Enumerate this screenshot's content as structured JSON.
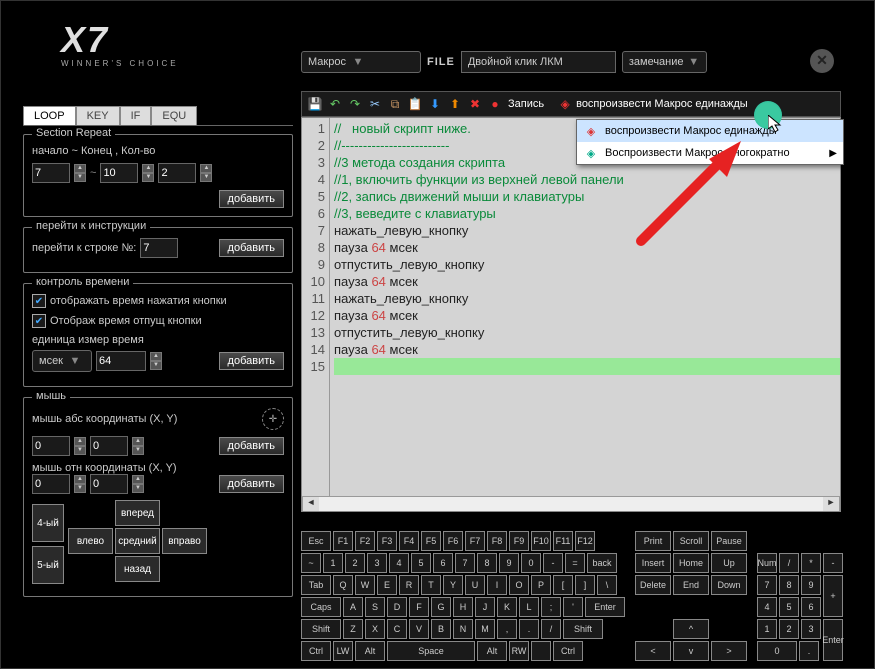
{
  "logo": {
    "main": "X7",
    "sub": "WINNER'S CHOICE"
  },
  "topbar": {
    "macro_dd": "Макрос",
    "file_label": "FILE",
    "file_value": "Двойной клик ЛКМ",
    "comment_dd": "замечание"
  },
  "tabs": {
    "loop": "LOOP",
    "key": "KEY",
    "if": "IF",
    "equ": "EQU"
  },
  "section_repeat": {
    "title": "Section Repeat",
    "row_label": "начало ~ Конец , Кол-во",
    "start": "7",
    "end": "10",
    "count": "2",
    "add": "добавить"
  },
  "goto": {
    "title": "перейти к инструкции",
    "label": "перейти к строке №:",
    "value": "7",
    "add": "добавить"
  },
  "timing": {
    "title": "контроль времени",
    "cb1": "отображать время нажатия кнопки",
    "cb2": "Отображ время отпущ кнопки",
    "unit_label": "единица измер  время",
    "unit": "мсек",
    "time": "64",
    "add": "добавить"
  },
  "mouse": {
    "title": "мышь",
    "abs_label": "мышь абс координаты (X, Y)",
    "rel_label": "мышь отн координаты (X, Y)",
    "x1": "0",
    "y1": "0",
    "x2": "0",
    "y2": "0",
    "add": "добавить",
    "btns": {
      "b4": "4-ый",
      "b5": "5-ый",
      "left": "влево",
      "mid": "средний",
      "right": "вправо",
      "fwd": "вперед",
      "back": "назад"
    }
  },
  "toolbar": {
    "record": "Запись",
    "play_once": "воспроизвести Макрос единажды"
  },
  "context_menu": {
    "item1": "воспроизвести Макрос единажды",
    "item2": "Воспроизвести Макрос многократно"
  },
  "code": {
    "lines": [
      {
        "n": 1,
        "cls": "comment",
        "text": "//   новый скрипт ниже."
      },
      {
        "n": 2,
        "cls": "comment",
        "text": "//-------------------------"
      },
      {
        "n": 3,
        "cls": "comment",
        "text": "//3 метода создания скрипта"
      },
      {
        "n": 4,
        "cls": "comment",
        "text": "//1, включить функции из верхней левой панели"
      },
      {
        "n": 5,
        "cls": "comment",
        "text": "//2, запись движений мыши и клавиатуры"
      },
      {
        "n": 6,
        "cls": "comment",
        "text": "//3, веведите с клавиатуры"
      },
      {
        "n": 7,
        "cls": "plain",
        "text": "нажать_левую_кнопку"
      },
      {
        "n": 8,
        "cls": "mixed",
        "text": "пауза ",
        "num": "64",
        "suffix": " мсек"
      },
      {
        "n": 9,
        "cls": "plain",
        "text": "отпустить_левую_кнопку"
      },
      {
        "n": 10,
        "cls": "mixed",
        "text": "пауза ",
        "num": "64",
        "suffix": " мсек"
      },
      {
        "n": 11,
        "cls": "plain",
        "text": "нажать_левую_кнопку"
      },
      {
        "n": 12,
        "cls": "mixed",
        "text": "пауза ",
        "num": "64",
        "suffix": " мсек"
      },
      {
        "n": 13,
        "cls": "plain",
        "text": "отпустить_левую_кнопку"
      },
      {
        "n": 14,
        "cls": "mixed",
        "text": "пауза ",
        "num": "64",
        "suffix": " мсек"
      },
      {
        "n": 15,
        "cls": "current",
        "text": ""
      }
    ]
  },
  "keyboard": {
    "row0": [
      "Esc",
      "F1",
      "F2",
      "F3",
      "F4",
      "F5",
      "F6",
      "F7",
      "F8",
      "F9",
      "F10",
      "F11",
      "F12"
    ],
    "row0b": [
      "Print",
      "Scroll",
      "Pause"
    ],
    "row1": [
      "~",
      "1",
      "2",
      "3",
      "4",
      "5",
      "6",
      "7",
      "8",
      "9",
      "0",
      "-",
      "=",
      "back"
    ],
    "row1b": [
      "Insert",
      "Home",
      "Up"
    ],
    "row1c": [
      "Num",
      "/",
      "*",
      "-"
    ],
    "row2": [
      "Tab",
      "Q",
      "W",
      "E",
      "R",
      "T",
      "Y",
      "U",
      "I",
      "O",
      "P",
      "[",
      "]",
      "\\"
    ],
    "row2b": [
      "Delete",
      "End",
      "Down"
    ],
    "row2c": [
      "7",
      "8",
      "9"
    ],
    "row2d": "+",
    "row3": [
      "Caps",
      "A",
      "S",
      "D",
      "F",
      "G",
      "H",
      "J",
      "K",
      "L",
      ";",
      "'",
      "Enter"
    ],
    "row3c": [
      "4",
      "5",
      "6"
    ],
    "row4": [
      "Shift",
      "Z",
      "X",
      "C",
      "V",
      "B",
      "N",
      "M",
      ",",
      ".",
      "/",
      "Shift"
    ],
    "row4b": [
      "^"
    ],
    "row4c": [
      "1",
      "2",
      "3"
    ],
    "row4d": "Enter",
    "row5": [
      "Ctrl",
      "LW",
      "Alt",
      "Space",
      "Alt",
      "RW",
      "",
      "Ctrl"
    ],
    "row5b": [
      "<",
      "v",
      ">"
    ],
    "row5c": [
      "0",
      "."
    ]
  }
}
